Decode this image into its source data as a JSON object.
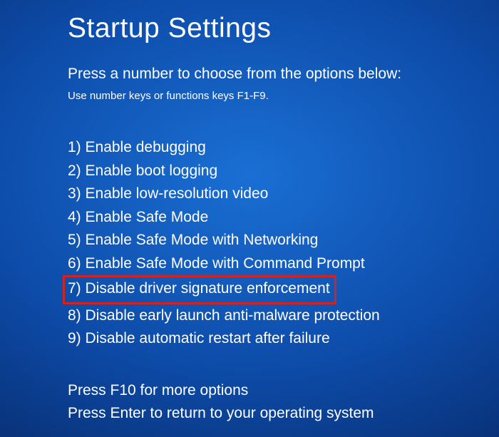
{
  "title": "Startup Settings",
  "subtitle": "Press a number to choose from the options below:",
  "hint": "Use number keys or functions keys F1-F9.",
  "options": [
    {
      "num": "1",
      "label": "Enable debugging",
      "highlight": false
    },
    {
      "num": "2",
      "label": "Enable boot logging",
      "highlight": false
    },
    {
      "num": "3",
      "label": "Enable low-resolution video",
      "highlight": false
    },
    {
      "num": "4",
      "label": "Enable Safe Mode",
      "highlight": false
    },
    {
      "num": "5",
      "label": "Enable Safe Mode with Networking",
      "highlight": false
    },
    {
      "num": "6",
      "label": "Enable Safe Mode with Command Prompt",
      "highlight": false
    },
    {
      "num": "7",
      "label": "Disable driver signature enforcement",
      "highlight": true
    },
    {
      "num": "8",
      "label": "Disable early launch anti-malware protection",
      "highlight": false
    },
    {
      "num": "9",
      "label": "Disable automatic restart after failure",
      "highlight": false
    }
  ],
  "footer": {
    "more": "Press F10 for more options",
    "return": "Press Enter to return to your operating system"
  },
  "highlight_color": "#d4221e"
}
